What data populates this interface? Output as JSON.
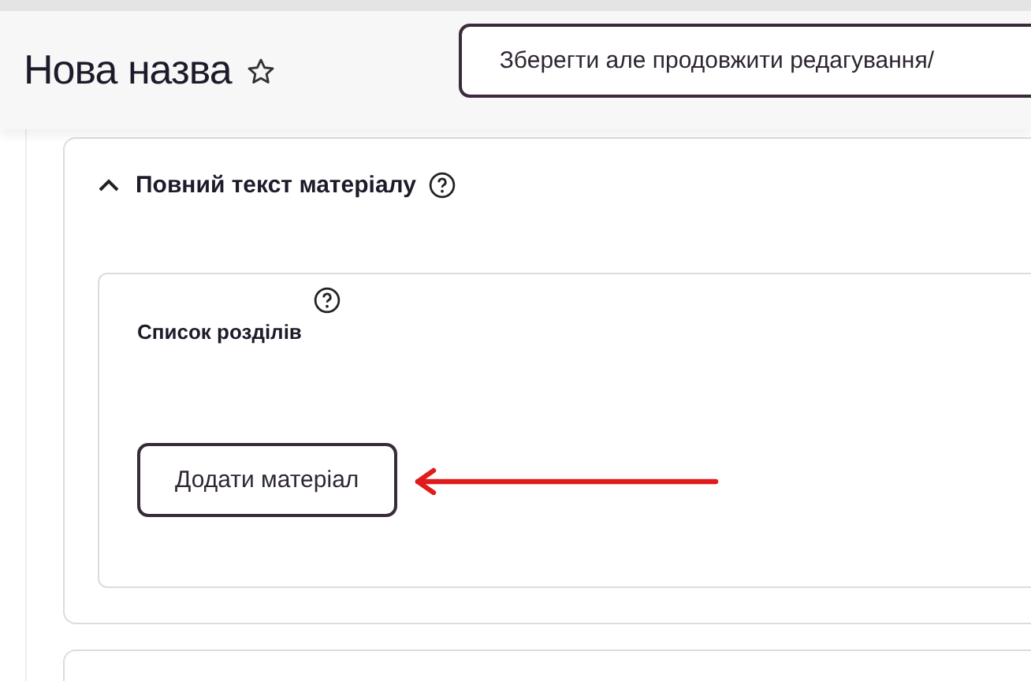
{
  "header": {
    "title": "Нова назва",
    "starred": false,
    "save_button": "Зберегти але продовжити редагування/"
  },
  "section": {
    "title": "Повний текст матеріалу",
    "expanded": true,
    "field": {
      "label": "Список розділів",
      "button": "Додати матеріал"
    }
  }
}
